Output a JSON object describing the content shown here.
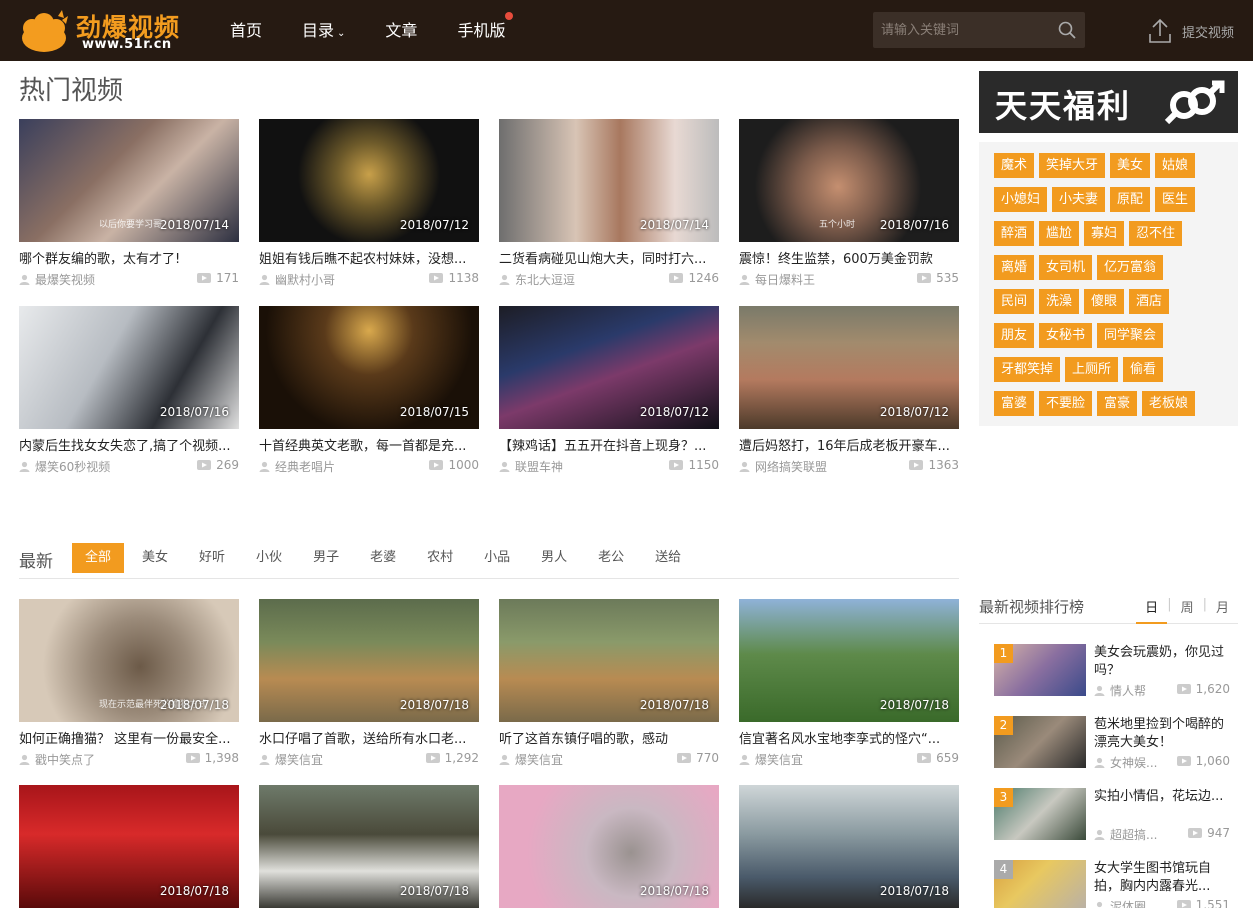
{
  "header": {
    "logo_title": "劲爆视频",
    "logo_url": "www.51r.cn",
    "nav": [
      {
        "label": "首页"
      },
      {
        "label": "目录",
        "has_dropdown": true
      },
      {
        "label": "文章"
      },
      {
        "label": "手机版",
        "has_badge": true
      }
    ],
    "search_placeholder": "请输入关键词",
    "upload_label": "提交视频"
  },
  "hot": {
    "title": "热门视频",
    "videos": [
      {
        "title": "哪个群友编的歌，太有才了!",
        "author": "最爆笑视频",
        "plays": "171",
        "date": "2018/07/14",
        "caption": "以后你要学习哥"
      },
      {
        "title": "姐姐有钱后瞧不起农村妹妹，没想...",
        "author": "幽默村小哥",
        "plays": "1138",
        "date": "2018/07/12",
        "caption": ""
      },
      {
        "title": "二货看病碰见山炮大夫，同时打六...",
        "author": "东北大逗逗",
        "plays": "1246",
        "date": "2018/07/14",
        "caption": ""
      },
      {
        "title": "震惊！终生监禁，600万美金罚款",
        "author": "每日爆料王",
        "plays": "535",
        "date": "2018/07/16",
        "caption": "五个小时"
      },
      {
        "title": "内蒙后生找女女失恋了,搞了个视频...",
        "author": "爆笑60秒视频",
        "plays": "269",
        "date": "2018/07/16",
        "caption": ""
      },
      {
        "title": "十首经典英文老歌，每一首都是充...",
        "author": "经典老唱片",
        "plays": "1000",
        "date": "2018/07/15",
        "caption": ""
      },
      {
        "title": "【辣鸡话】五五开在抖音上现身？...",
        "author": "联盟车神",
        "plays": "1150",
        "date": "2018/07/12",
        "caption": ""
      },
      {
        "title": "遭后妈怒打，16年后成老板开豪车...",
        "author": "网络搞笑联盟",
        "plays": "1363",
        "date": "2018/07/12",
        "caption": ""
      }
    ]
  },
  "banner": {
    "text": "天天福利"
  },
  "tags": [
    [
      "魔术",
      "笑掉大牙",
      "美女",
      "姑娘"
    ],
    [
      "小媳妇",
      "小夫妻",
      "原配",
      "医生"
    ],
    [
      "醉酒",
      "尴尬",
      "寡妇",
      "忍不住"
    ],
    [
      "离婚",
      "女司机",
      "亿万富翁"
    ],
    [
      "民间",
      "洗澡",
      "傻眼",
      "酒店"
    ],
    [
      "朋友",
      "女秘书",
      "同学聚会"
    ],
    [
      "牙都笑掉",
      "上厕所",
      "偷看"
    ],
    [
      "富婆",
      "不要脸",
      "富豪",
      "老板娘"
    ]
  ],
  "latest": {
    "title": "最新",
    "tabs": [
      "全部",
      "美女",
      "好听",
      "小伙",
      "男子",
      "老婆",
      "农村",
      "小品",
      "男人",
      "老公",
      "送给"
    ],
    "active_tab": "全部",
    "videos": [
      {
        "title": "如何正确撸猫？ 这里有一份最安全...",
        "author": "戳中笑点了",
        "plays": "1,398",
        "date": "2018/07/18",
        "caption": "现在示范最伴死的撸猫方式"
      },
      {
        "title": "水口仔唱了首歌，送给所有水口老...",
        "author": "爆笑信宜",
        "plays": "1,292",
        "date": "2018/07/18",
        "caption": ""
      },
      {
        "title": "听了这首东镇仔唱的歌，感动",
        "author": "爆笑信宜",
        "plays": "770",
        "date": "2018/07/18",
        "caption": ""
      },
      {
        "title": "信宜著名风水宝地李孪式的怪穴“...",
        "author": "爆笑信宜",
        "plays": "659",
        "date": "2018/07/18",
        "caption": ""
      },
      {
        "title": "",
        "author": "",
        "plays": "",
        "date": "2018/07/18",
        "caption": ""
      },
      {
        "title": "",
        "author": "",
        "plays": "",
        "date": "2018/07/18",
        "caption": ""
      },
      {
        "title": "",
        "author": "",
        "plays": "",
        "date": "2018/07/18",
        "caption": ""
      },
      {
        "title": "",
        "author": "",
        "plays": "",
        "date": "2018/07/18",
        "caption": ""
      }
    ]
  },
  "ranking": {
    "title": "最新视频排行榜",
    "tabs": [
      "日",
      "周",
      "月"
    ],
    "active_tab": "日",
    "items": [
      {
        "rank": "1",
        "title": "美女会玩震奶，你见过吗？",
        "author": "情人帮",
        "plays": "1,620"
      },
      {
        "rank": "2",
        "title": "苞米地里捡到个喝醉的漂亮大美女！",
        "author": "女神娱...",
        "plays": "1,060"
      },
      {
        "rank": "3",
        "title": "实拍小情侣，花坛边...",
        "author": "超超搞...",
        "plays": "947"
      },
      {
        "rank": "4",
        "title": "女大学生图书馆玩自拍，胸内内露春光...",
        "author": "泥体圈",
        "plays": "1,551"
      }
    ]
  },
  "colors": {
    "header_bg": "#261a12",
    "accent": "#f29b1f",
    "text_muted": "#999999"
  }
}
